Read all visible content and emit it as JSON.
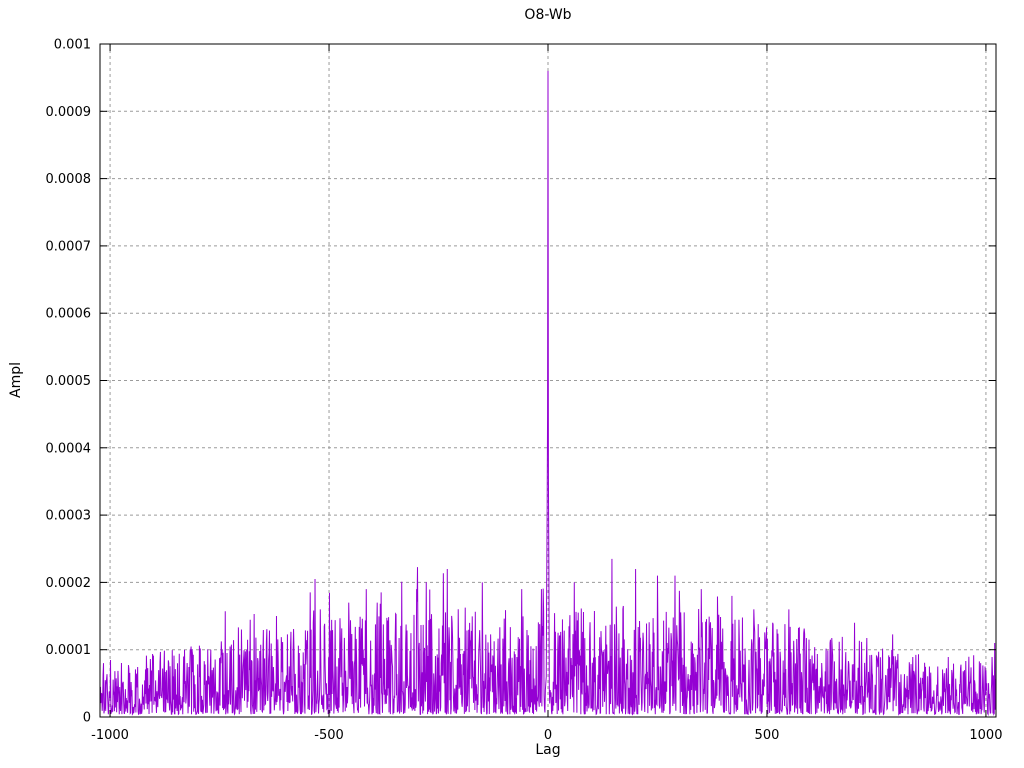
{
  "window": {
    "background": "#ffffff"
  },
  "chart_data": {
    "type": "line",
    "title": "O8-Wb",
    "xlabel": "Lag",
    "ylabel": "Ampl",
    "legend_position": "none",
    "grid": true,
    "xlim": [
      -1023,
      1023
    ],
    "ylim": [
      0,
      0.001
    ],
    "x_ticks": [
      {
        "value": -1000,
        "label": "-1000"
      },
      {
        "value": -500,
        "label": "-500"
      },
      {
        "value": 0,
        "label": "0"
      },
      {
        "value": 500,
        "label": "500"
      },
      {
        "value": 1000,
        "label": "1000"
      }
    ],
    "y_ticks": [
      {
        "value": 0,
        "label": "0"
      },
      {
        "value": 0.0001,
        "label": "0.0001"
      },
      {
        "value": 0.0002,
        "label": "0.0002"
      },
      {
        "value": 0.0003,
        "label": "0.0003"
      },
      {
        "value": 0.0004,
        "label": "0.0004"
      },
      {
        "value": 0.0005,
        "label": "0.0005"
      },
      {
        "value": 0.0006,
        "label": "0.0006"
      },
      {
        "value": 0.0007,
        "label": "0.0007"
      },
      {
        "value": 0.0008,
        "label": "0.0008"
      },
      {
        "value": 0.0009,
        "label": "0.0009"
      },
      {
        "value": 0.001,
        "label": "0.001"
      }
    ],
    "colors": {
      "line": "#9400d3",
      "grid": "#9b9b9b",
      "axis": "#000000",
      "text": "#000000"
    },
    "description": "Autocorrelation-style amplitude vs lag; sharp dominant peak at lag 0 over a broad symmetric noise floor that rises toward the center",
    "main_peak": {
      "lag": 0,
      "value": 0.00096
    },
    "peak_points": [
      [
        -6,
        4e-05
      ],
      [
        -5,
        5e-05
      ],
      [
        -4,
        6e-05
      ],
      [
        -3,
        0.0002
      ],
      [
        -2,
        0.0003
      ],
      [
        -1,
        0.00045
      ],
      [
        0,
        0.00096
      ],
      [
        1,
        0.00035
      ],
      [
        2,
        0.00022
      ],
      [
        3,
        4e-05
      ],
      [
        4,
        2e-05
      ],
      [
        5,
        4e-05
      ],
      [
        6,
        3e-05
      ]
    ],
    "notable_spikes": [
      [
        -830,
        0.0001
      ],
      [
        -700,
        0.00013
      ],
      [
        -620,
        0.00015
      ],
      [
        -520,
        0.00016
      ],
      [
        -455,
        0.00017
      ],
      [
        -415,
        0.00019
      ],
      [
        -390,
        0.00017
      ],
      [
        -300,
        0.00019
      ],
      [
        -230,
        0.00022
      ],
      [
        -150,
        0.0002
      ],
      [
        -60,
        0.00019
      ],
      [
        -15,
        0.00019
      ],
      [
        60,
        0.0002
      ],
      [
        146,
        0.000235
      ],
      [
        200,
        0.00022
      ],
      [
        250,
        0.00021
      ],
      [
        290,
        0.00021
      ],
      [
        350,
        0.00019
      ],
      [
        420,
        0.00018
      ],
      [
        470,
        0.00016
      ],
      [
        550,
        0.00016
      ],
      [
        700,
        0.00014
      ],
      [
        1020,
        0.00011
      ]
    ],
    "noise": {
      "seed": 1337,
      "step": 1,
      "floor": 4e-06,
      "bias_power": 1.7,
      "spike_prob": 0.015,
      "spike_gain_min": 1.05,
      "spike_gain_max": 1.45,
      "max_value_cap": 0.000245,
      "envelope_band_max": [
        [
          -1023,
          9e-05
        ],
        [
          -900,
          9.5e-05
        ],
        [
          -800,
          0.00011
        ],
        [
          -700,
          0.000125
        ],
        [
          -600,
          0.000135
        ],
        [
          -500,
          0.000145
        ],
        [
          -400,
          0.000155
        ],
        [
          -300,
          0.00016
        ],
        [
          -200,
          0.000165
        ],
        [
          -100,
          0.00016
        ],
        [
          0,
          0.00016
        ],
        [
          100,
          0.000165
        ],
        [
          200,
          0.00017
        ],
        [
          300,
          0.000165
        ],
        [
          400,
          0.000155
        ],
        [
          500,
          0.000145
        ],
        [
          600,
          0.00013
        ],
        [
          700,
          0.000115
        ],
        [
          800,
          0.0001
        ],
        [
          900,
          9e-05
        ],
        [
          1023,
          9.5e-05
        ]
      ]
    }
  }
}
